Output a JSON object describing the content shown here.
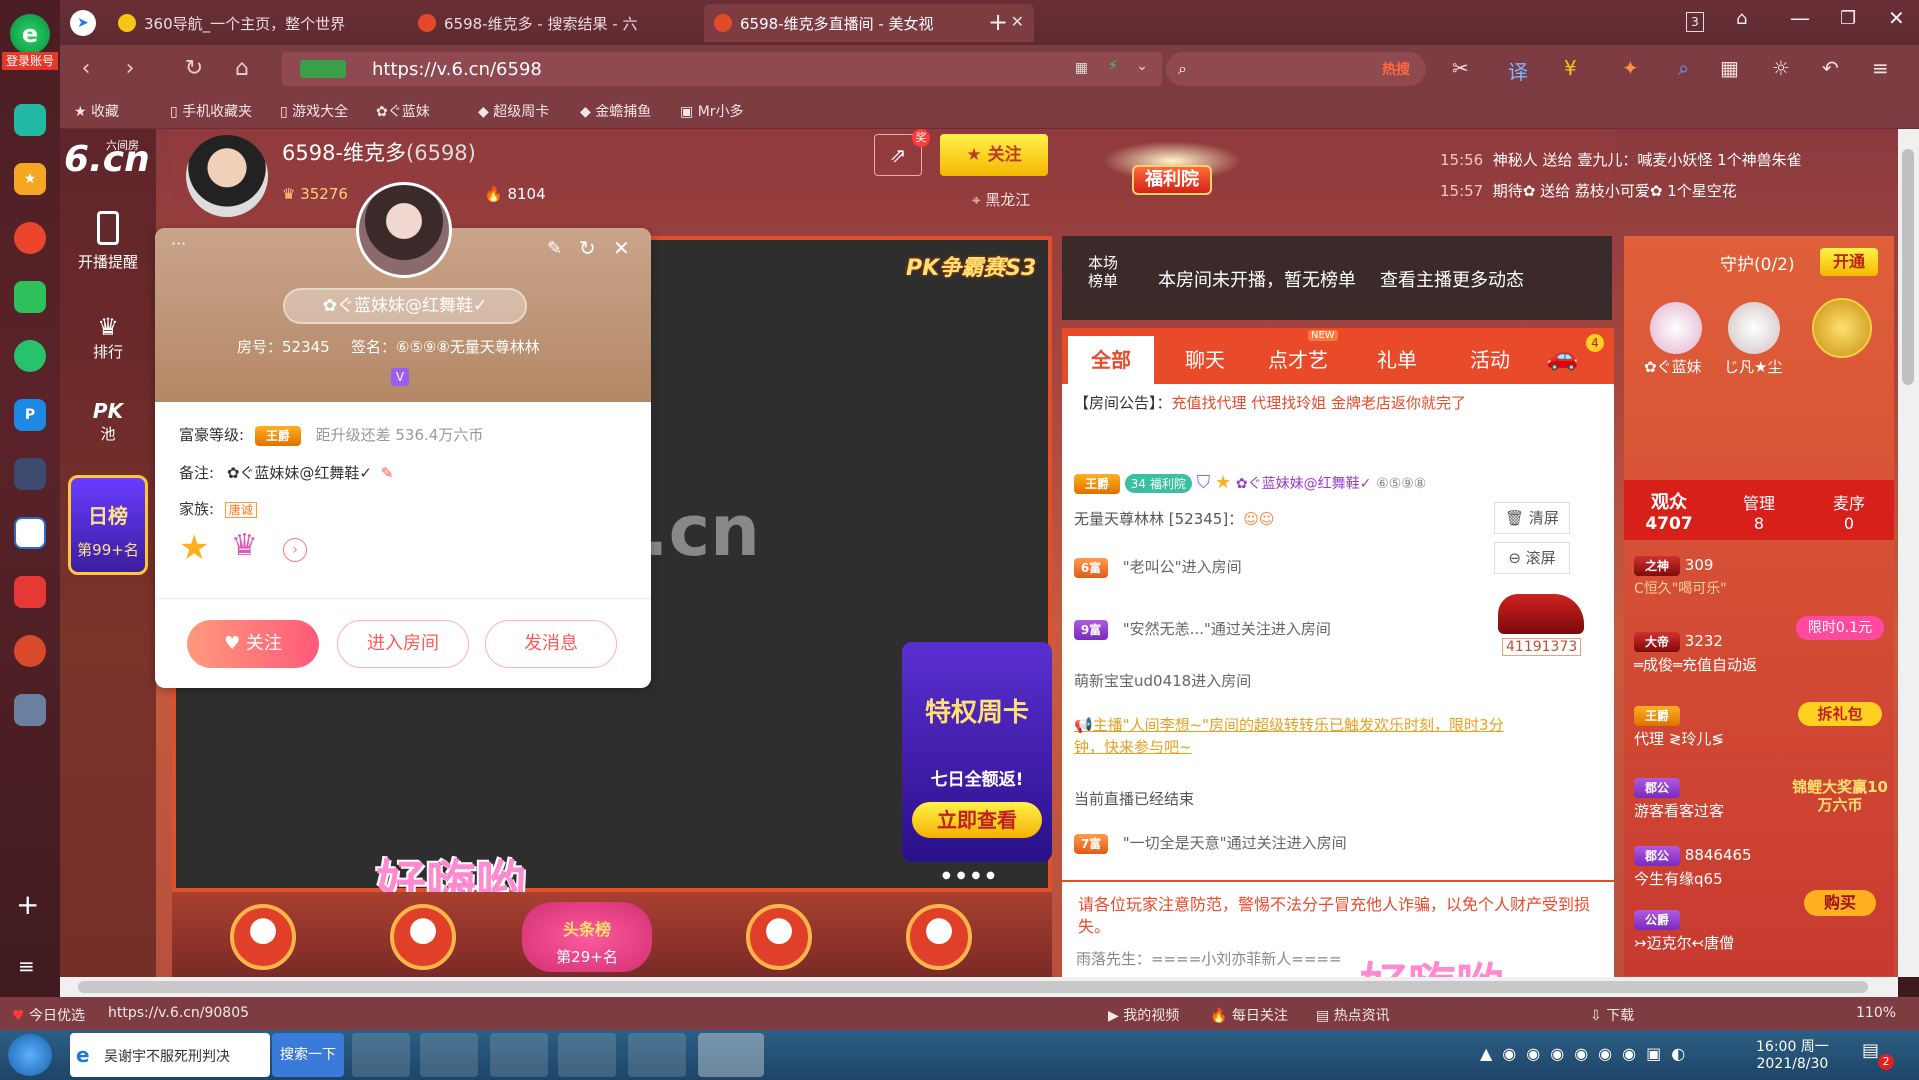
{
  "browser": {
    "account_label": "登录账号",
    "tabs": [
      {
        "title": "360导航_一个主页，整个世界"
      },
      {
        "title": "6598-维克多 - 搜索结果 - 六"
      },
      {
        "title": "6598-维克多直播间 - 美女视"
      }
    ],
    "url": "https://v.6.cn/6598",
    "search_hot": "热搜",
    "badge_3": "3",
    "bookmarks": [
      "收藏",
      "手机收藏夹",
      "游戏大全",
      "ぐ蓝妹",
      "超级周卡",
      "金蟾捕鱼",
      "Mr小多"
    ]
  },
  "site": {
    "logo_text": "6.cn",
    "logo_sub": "六间房",
    "nav": [
      {
        "label": "开播提醒",
        "icon": "phone-icon"
      },
      {
        "label": "排行",
        "icon": "crown-icon"
      },
      {
        "label": "PK池",
        "icon": "pk-icon"
      }
    ],
    "daily_rank_title": "日榜",
    "daily_rank_value": "第99+名"
  },
  "host": {
    "name": "6598-维克多",
    "room_id": "(6598)",
    "coins": "35276",
    "fire": "8104",
    "location": "黑龙江",
    "follow_label": "关注",
    "new_label": "奖"
  },
  "fuliyuan_label": "福利院",
  "gift_feed": [
    {
      "time": "15:56",
      "text": "神秘人 送给 壹九儿：喊麦小妖怪 1个神兽朱雀"
    },
    {
      "time": "15:57",
      "text": "期待✿ 送给 荔枝小可爱✿ 1个星空花"
    }
  ],
  "user_card": {
    "name": "✿ぐ蓝妹妹@红舞鞋✓",
    "room_no": "房号：52345",
    "signature": "签名：⑥⑤⑨⑧无量天尊林林",
    "wealth_label": "富豪等级:",
    "wealth_badge": "王爵",
    "upgrade_text": "距升级还差 536.4万六币",
    "remark_label": "备注:",
    "remark_value": "✿ぐ蓝妹妹@红舞鞋✓",
    "family_label": "家族:",
    "family_value": "唐诚",
    "follow_btn": "关注",
    "enter_btn": "进入房间",
    "message_btn": "发消息",
    "v_badge": "V"
  },
  "video": {
    "pk_banner": "PK争霸赛S3",
    "overlay_text": "好嗨哟",
    "weekly_card_title": "特权周卡",
    "weekly_card_sub": "七日全额返!",
    "weekly_card_btn": "立即查看",
    "bottom_rank": "头条榜",
    "bottom_rank_value": "第29+名"
  },
  "chat": {
    "rank_label": "本场榜单",
    "rank_text": "本房间未开播，暂无榜单",
    "more_link": "查看主播更多动态",
    "tabs": [
      "全部",
      "聊天",
      "点才艺",
      "礼单",
      "活动"
    ],
    "new_tag": "NEW",
    "car_count": "4",
    "notice_label": "【房间公告】：",
    "notice_text": "充值找代理 代理找玲姐 金牌老店返你就完了",
    "msg1_badge": "王爵",
    "msg1_level": "34",
    "msg1_club": "福利院",
    "msg1_name": "✿ぐ蓝妹妹@红舞鞋✓",
    "msg1_suffix": "⑥⑤⑨⑧",
    "msg1_line2": "无量天尊林林 [52345]：",
    "clear_btn": "清屏",
    "scroll_btn": "滚屏",
    "msg2_rank": "6富",
    "msg2_text": "\"老叫公\"进入房间",
    "msg3_rank": "9富",
    "msg3_text": "\"安然无恙...\"通过关注进入房间",
    "msg3_num": "41191373",
    "msg4_text": "萌新宝宝ud0418进入房间",
    "msg5_text": "主播\"人间李想~\"房间的超级转转乐已触发欢乐时刻，限时3分钟，快来参与吧~",
    "msg6_text": "当前直播已经结束",
    "msg7_rank": "7富",
    "msg7_text": "\"一切全是天意\"通过关注进入房间",
    "warning": "请各位玩家注意防范，警惕不法分子冒充他人诈骗，以免个人财产受到损失。",
    "bottom_line": "雨落先生：====小刘亦菲新人===="
  },
  "guard": {
    "title": "守护(0/2)",
    "open_btn": "开通",
    "members": [
      {
        "name": "✿ぐ蓝妹"
      },
      {
        "name": "じ凡★尘"
      }
    ],
    "tabs": [
      {
        "label": "观众",
        "count": "4707"
      },
      {
        "label": "管理",
        "count": "8"
      },
      {
        "label": "麦序",
        "count": "0"
      }
    ],
    "viewers": [
      {
        "badge": "之神",
        "num": "309",
        "name": "C恒久\"喝可乐\""
      },
      {
        "badge": "大帝",
        "num": "3232",
        "name": "═成俊═充值自动返"
      },
      {
        "badge": "王爵",
        "num": "",
        "name": "代理 ≷玲儿≶"
      },
      {
        "badge": "郡公",
        "num": "",
        "name": "游客看客过客"
      },
      {
        "badge": "郡公",
        "num": "8846465",
        "name": "今生有缘q65"
      },
      {
        "badge": "公爵",
        "num": "",
        "name": "↣迈克尔↢唐僧"
      }
    ],
    "promo_limit": "限时0.1元",
    "promo_gift": "拆礼包",
    "promo_prize": "锦鲤大奖赢10万六币",
    "promo_buy": "购买"
  },
  "status": {
    "today_pick": "今日优选",
    "link": "https://v.6.cn/90805",
    "my_video": "我的视频",
    "daily_follow": "每日关注",
    "hot_news": "热点资讯",
    "download": "下载",
    "zoom": "110%"
  },
  "taskbar": {
    "search_text": "吴谢宇不服死刑判决",
    "search_btn": "搜索一下",
    "time": "16:00 周一",
    "date": "2021/8/30",
    "notif_count": "2"
  }
}
